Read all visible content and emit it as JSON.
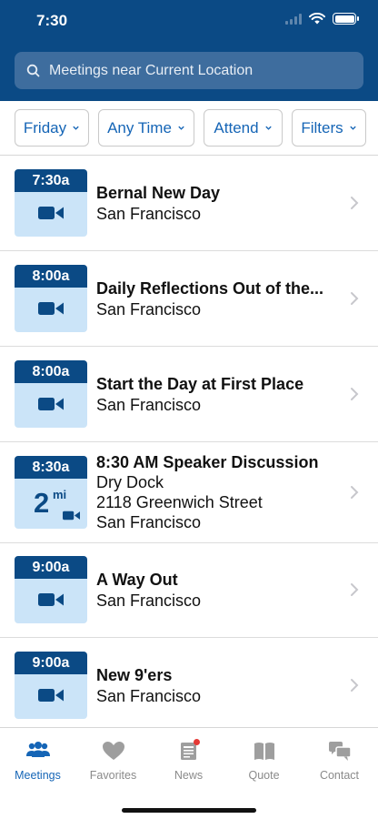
{
  "status_bar": {
    "time": "7:30"
  },
  "search": {
    "placeholder": "Meetings near Current Location"
  },
  "filters": [
    {
      "label": "Friday"
    },
    {
      "label": "Any Time"
    },
    {
      "label": "Attend"
    },
    {
      "label": "Filters"
    }
  ],
  "meetings": [
    {
      "time": "7:30a",
      "title": "Bernal New Day",
      "lines": [
        "San Francisco"
      ],
      "online": true
    },
    {
      "time": "8:00a",
      "title": "Daily Reflections Out of the...",
      "lines": [
        "San Francisco"
      ],
      "online": true
    },
    {
      "time": "8:00a",
      "title": "Start the Day at First Place",
      "lines": [
        "San Francisco"
      ],
      "online": true
    },
    {
      "time": "8:30a",
      "title": "8:30 AM Speaker Discussion",
      "lines": [
        "Dry Dock",
        "2118 Greenwich Street",
        "San Francisco"
      ],
      "distance": "2",
      "distance_unit": "mi",
      "online": true
    },
    {
      "time": "9:00a",
      "title": "A Way Out",
      "lines": [
        "San Francisco"
      ],
      "online": true
    },
    {
      "time": "9:00a",
      "title": "New 9'ers",
      "lines": [
        "San Francisco"
      ],
      "online": true
    }
  ],
  "tabs": [
    {
      "label": "Meetings",
      "icon": "people-icon",
      "active": true
    },
    {
      "label": "Favorites",
      "icon": "heart-icon",
      "active": false
    },
    {
      "label": "News",
      "icon": "newspaper-icon",
      "active": false,
      "notification_dot": true
    },
    {
      "label": "Quote",
      "icon": "book-icon",
      "active": false
    },
    {
      "label": "Contact",
      "icon": "chat-bubbles-icon",
      "active": false
    }
  ],
  "colors": {
    "brand": "#0b4a85",
    "accent": "#1565b6",
    "badge_bg": "#cbe4f8",
    "notification": "#e53935"
  }
}
